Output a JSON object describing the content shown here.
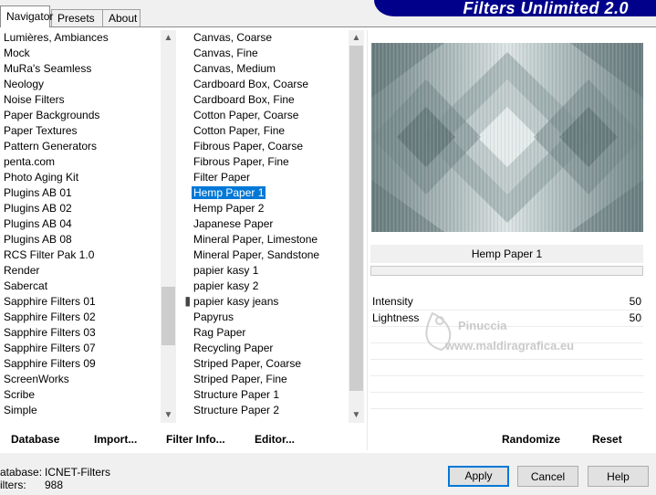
{
  "tabs": [
    "Navigator",
    "Presets",
    "About"
  ],
  "banner_title": "Filters Unlimited 2.0",
  "categories": [
    "Lumières, Ambiances",
    "Mock",
    "MuRa's Seamless",
    "Neology",
    "Noise Filters",
    "Paper Backgrounds",
    "Paper Textures",
    "Pattern Generators",
    "penta.com",
    "Photo Aging Kit",
    "Plugins AB 01",
    "Plugins AB 02",
    "Plugins AB 04",
    "Plugins AB 08",
    "RCS Filter Pak 1.0",
    "Render",
    "Sabercat",
    "Sapphire Filters 01",
    "Sapphire Filters 02",
    "Sapphire Filters 03",
    "Sapphire Filters 07",
    "Sapphire Filters 09",
    "ScreenWorks",
    "Scribe",
    "Simple"
  ],
  "filters": [
    "Canvas, Coarse",
    "Canvas, Fine",
    "Canvas, Medium",
    "Cardboard Box, Coarse",
    "Cardboard Box, Fine",
    "Cotton Paper, Coarse",
    "Cotton Paper, Fine",
    "Fibrous Paper, Coarse",
    "Fibrous Paper, Fine",
    "Filter Paper",
    "Hemp Paper 1",
    "Hemp Paper 2",
    "Japanese Paper",
    "Mineral Paper, Limestone",
    "Mineral Paper, Sandstone",
    "papier kasy 1",
    "papier kasy 2",
    "papier kasy jeans",
    "Papyrus",
    "Rag Paper",
    "Recycling Paper",
    "Striped Paper, Coarse",
    "Striped Paper, Fine",
    "Structure Paper 1",
    "Structure Paper 2"
  ],
  "selected_filter_index": 10,
  "selected_filter_name": "Hemp Paper 1",
  "params": [
    {
      "label": "Intensity",
      "value": "50"
    },
    {
      "label": "Lightness",
      "value": "50"
    }
  ],
  "watermark": {
    "line1": "Pinuccia",
    "line2": "www.maldiragrafica.eu"
  },
  "actions": {
    "database": "Database",
    "import": "Import...",
    "filter_info": "Filter Info...",
    "editor": "Editor...",
    "randomize": "Randomize",
    "reset": "Reset"
  },
  "info": {
    "db_label": "atabase:",
    "db_value": "ICNET-Filters",
    "filters_label": "ilters:",
    "filters_value": "988"
  },
  "buttons": {
    "apply": "Apply",
    "cancel": "Cancel",
    "help": "Help"
  },
  "colors": {
    "selection": "#0078d7",
    "banner": "#00008a",
    "preview_tone": "#7f9294"
  }
}
